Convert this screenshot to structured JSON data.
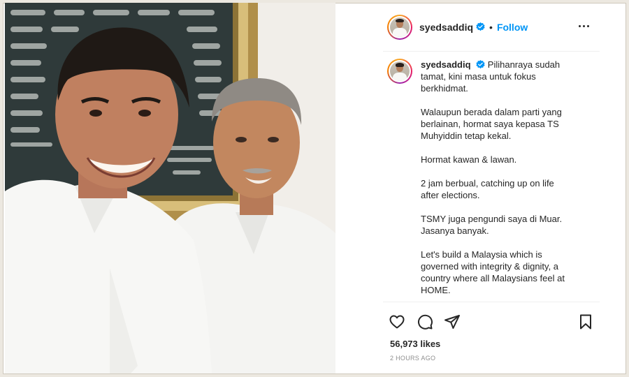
{
  "post": {
    "username": "syedsaddiq",
    "follow_label": "Follow",
    "separator": "•",
    "caption_paragraphs": [
      "Pilihanraya sudah tamat, kini masa untuk fokus berkhidmat.",
      "Walaupun berada dalam parti yang berlainan, hormat saya kepasa TS Muhyiddin tetap kekal.",
      "Hormat kawan & lawan.",
      "2 jam berbual, catching up on life after elections.",
      "TSMY juga pengundi saya di Muar. Jasanya banyak.",
      "Let's build a Malaysia which is governed with integrity & dignity, a country where all Malaysians feel at HOME."
    ],
    "likes_text": "56,973 likes",
    "time_text": "2 HOURS AGO"
  },
  "icons": {
    "verified": "verified-badge-icon",
    "more": "more-options-icon",
    "like": "heart-icon",
    "comment": "comment-icon",
    "share": "paper-plane-icon",
    "save": "bookmark-icon"
  },
  "colors": {
    "follow": "#0095f6",
    "verified": "#0095f6",
    "text": "#262626",
    "muted": "#8e8e8e"
  }
}
